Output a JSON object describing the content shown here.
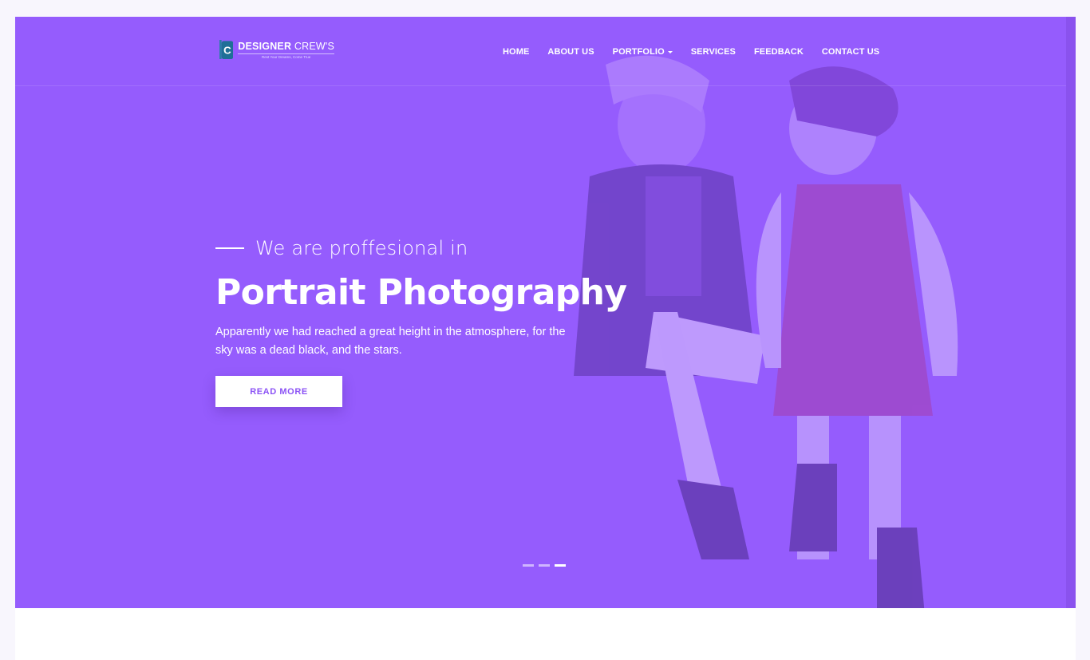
{
  "brand": {
    "name_bold": "DESIGNER",
    "name_light": "CREW'S",
    "tagline": "Rest Your Dreams, Come True",
    "mark_letter": "C"
  },
  "nav": {
    "items": [
      {
        "label": "HOME"
      },
      {
        "label": "ABOUT US"
      },
      {
        "label": "PORTFOLIO"
      },
      {
        "label": "SERVICES"
      },
      {
        "label": "FEEDBACK"
      },
      {
        "label": "CONTACT US"
      }
    ]
  },
  "hero": {
    "kicker": "We are proffesional in",
    "headline": "Portrait Photography",
    "description": "Apparently we had reached a great height in the atmosphere, for the sky was a dead black, and the stars.",
    "button_label": "READ MORE"
  },
  "slider": {
    "count": 3,
    "active_index": 2
  },
  "colors": {
    "hero_overlay": "#955cfd",
    "button_text": "#8b52f5",
    "page_bg": "#f8f6fd"
  }
}
